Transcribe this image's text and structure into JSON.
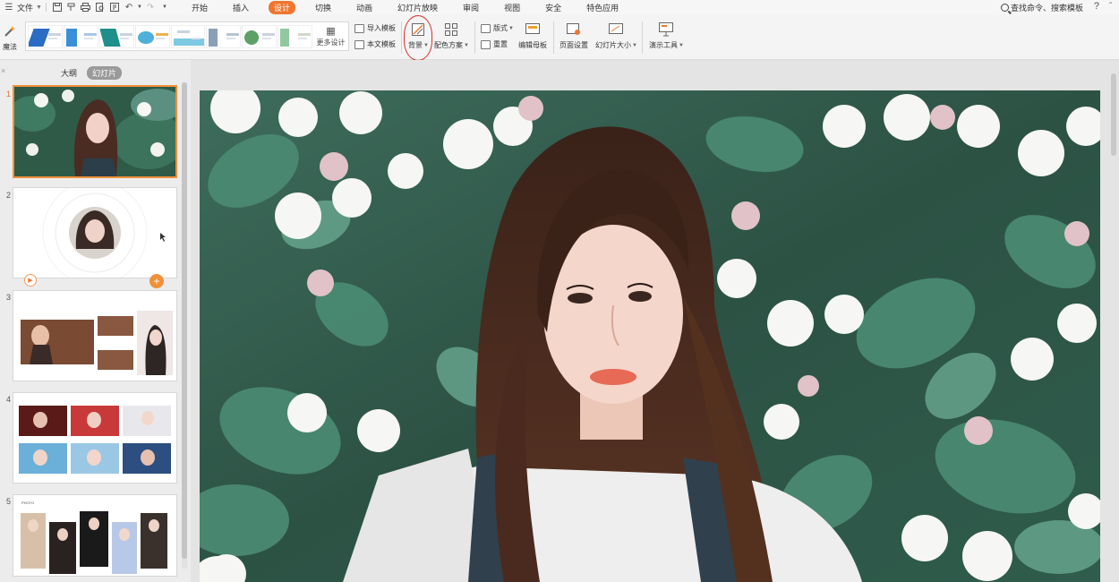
{
  "menubar": {
    "file_label": "文件",
    "tabs": [
      "开始",
      "插入",
      "设计",
      "切换",
      "动画",
      "幻灯片放映",
      "审阅",
      "视图",
      "安全",
      "特色应用"
    ],
    "active_tab": "设计",
    "search_text": "查找命令、搜索模板",
    "help_label": "?"
  },
  "ribbon": {
    "magic_label": "魔法",
    "more_design_label": "更多设计",
    "import_template_label": "导入模板",
    "text_template_label": "本文模板",
    "background_label": "背景",
    "color_scheme_label": "配色方案",
    "layout_label": "版式",
    "reset_label": "重置",
    "edit_master_label": "编辑母板",
    "page_setup_label": "页面设置",
    "slide_size_label": "幻灯片大小",
    "presentation_tools_label": "演示工具"
  },
  "left_pane": {
    "close_label": "×",
    "tabs": [
      "大纲",
      "幻灯片"
    ],
    "active_tab": "幻灯片",
    "slide_numbers": [
      "1",
      "2",
      "3",
      "4",
      "5"
    ],
    "selected_slide": 1,
    "slide5_caption": "PHOTO"
  },
  "colors": {
    "accent": "#f07630",
    "highlight_circle": "#d9302a",
    "foliage": "#2f5a48"
  }
}
